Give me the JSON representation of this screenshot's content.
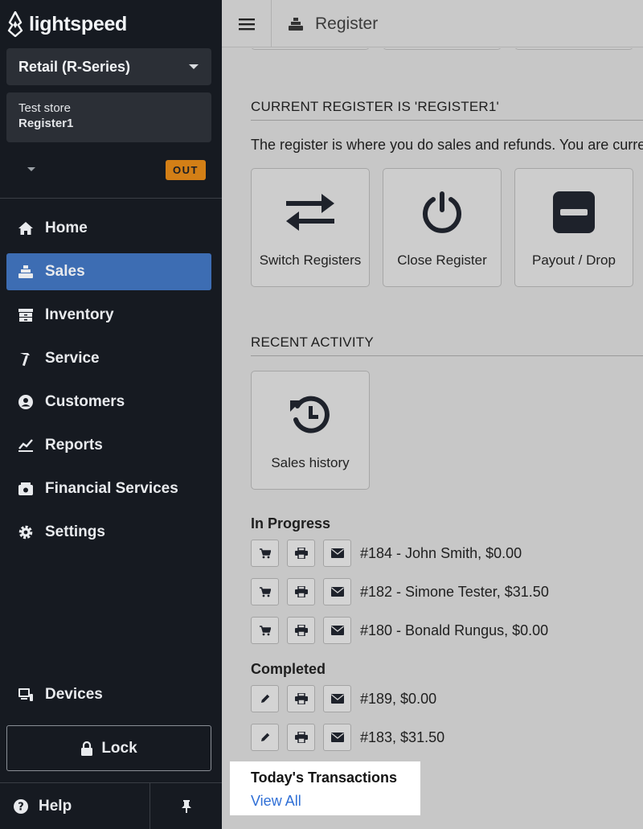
{
  "sidebar": {
    "brand": "lightspeed",
    "product": "Retail (R-Series)",
    "store": "Test store",
    "register": "Register1",
    "clock_badge": "OUT",
    "nav": [
      {
        "label": "Home",
        "icon": "home-icon"
      },
      {
        "label": "Sales",
        "icon": "cash-register-icon",
        "active": true
      },
      {
        "label": "Inventory",
        "icon": "inventory-icon"
      },
      {
        "label": "Service",
        "icon": "hammer-icon"
      },
      {
        "label": "Customers",
        "icon": "customer-icon"
      },
      {
        "label": "Reports",
        "icon": "chart-icon"
      },
      {
        "label": "Financial Services",
        "icon": "wallet-icon"
      },
      {
        "label": "Settings",
        "icon": "gear-icon"
      }
    ],
    "devices": "Devices",
    "lock": "Lock",
    "help": "Help"
  },
  "topbar": {
    "title": "Register"
  },
  "main": {
    "current_register_heading": "CURRENT REGISTER IS 'REGISTER1'",
    "intro": "The register is where you do sales and refunds. You are curre",
    "tiles": [
      {
        "label": "Switch Registers",
        "icon": "switch-arrows-icon"
      },
      {
        "label": "Close Register",
        "icon": "power-icon"
      },
      {
        "label": "Payout / Drop",
        "icon": "minus-square-icon"
      }
    ],
    "recent_heading": "RECENT ACTIVITY",
    "history_tile": {
      "label": "Sales history",
      "icon": "history-icon"
    },
    "in_progress_heading": "In Progress",
    "in_progress": [
      "#184 - John Smith, $0.00",
      "#182 - Simone Tester, $31.50",
      "#180 - Bonald Rungus, $0.00"
    ],
    "completed_heading": "Completed",
    "completed": [
      "#189, $0.00",
      "#183, $31.50"
    ],
    "today_heading": "Today's Transactions",
    "view_all": "View All"
  },
  "colors": {
    "sidebar_bg": "#161a21",
    "active_nav": "#3d6db3",
    "out_badge": "#d37f16",
    "link": "#2f6fd6"
  }
}
